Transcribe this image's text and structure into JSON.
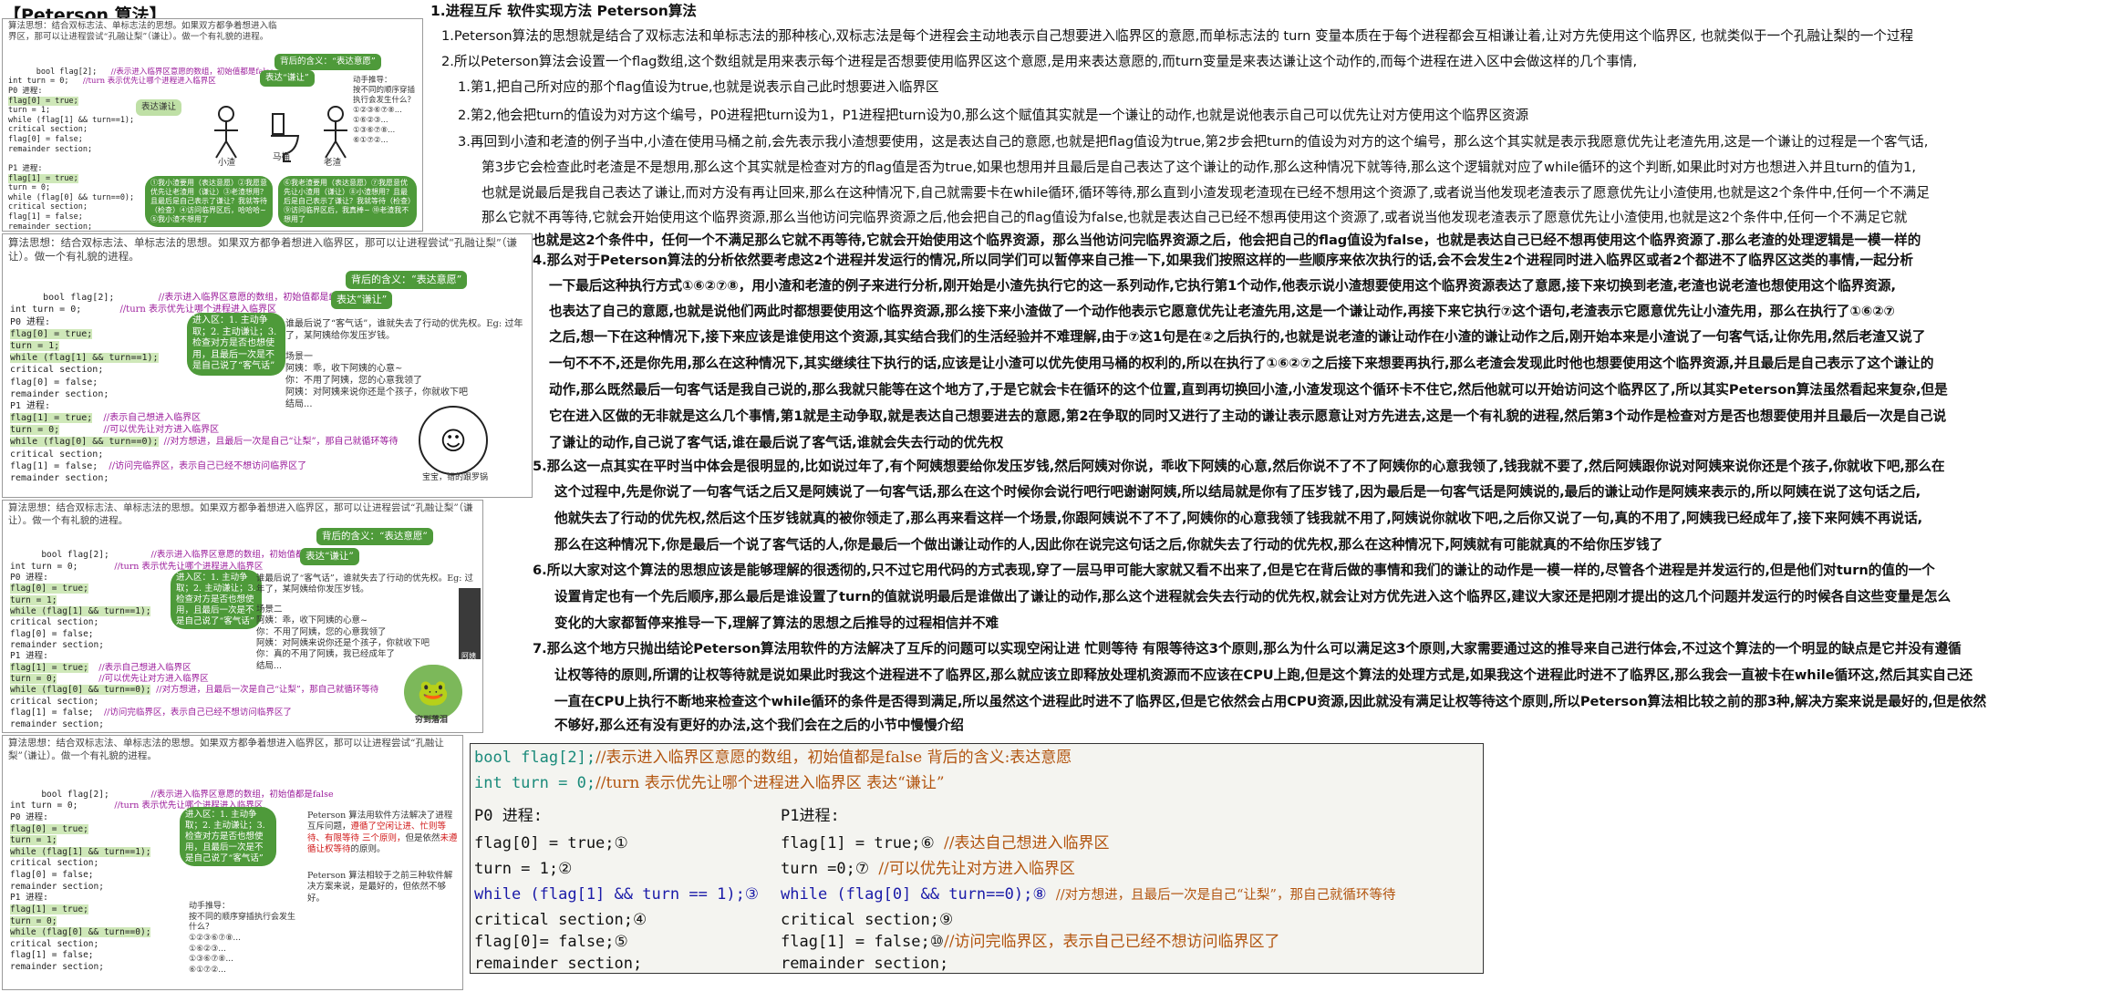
{
  "page_title": "【Peterson 算法】",
  "thumbs": {
    "intro": "算法思想：结合双标志法、单标志法的思想。如果双方都争着想进入临界区，那可以让进程尝试“孔融让梨”（谦让）。做一个有礼貌的进程。",
    "decl_flag": "bool flag[2];",
    "decl_flag_comment": "//表示进入临界区意愿的数组，初始值都是false",
    "decl_turn": "int turn = 0;",
    "decl_turn_comment": "//turn 表示优先让哪个进程进入临界区",
    "p0_label": "P0 进程:",
    "p1_label": "P1 进程:",
    "p0_lines": [
      "flag[0] = true;",
      "turn = 1;",
      "while (flag[1] && turn==1);",
      "critical section;",
      "flag[0] = false;",
      "remainder section;"
    ],
    "p0_nums": [
      "①",
      "②",
      "③",
      "④",
      "⑤"
    ],
    "p1_lines": [
      "flag[1] = true;",
      "turn = 0;",
      "while (flag[0] && turn==0);",
      "critical section;",
      "flag[1] = false;",
      "remainder section;"
    ],
    "p1_nums": [
      "⑥",
      "⑦",
      "⑧",
      "⑨",
      "⑩"
    ],
    "bubble_meaning": "背后的含义：“表达意愿”",
    "bubble_modesty": "表达“谦让”",
    "bubble_mark": "表达谦让",
    "bubble_p0": "①我小渣要用（表达意愿）②我愿意优先让老渣用（谦让）③老渣想用？且最后是自己表示了谦让？我就等待（检查）④访问临界区后，哈哈哈~ ⑤我小渣不想用了",
    "bubble_p1": "⑥我老渣要用（表达意愿）⑦我愿意优先让小渣用（谦让）⑧小渣想用？且最后是自己表示了谦让？我就等待（检查）⑨访问临界区后，我真棒~ ⑩老渣我不想用了",
    "enter_bubble": "进入区：1. 主动争取；2. 主动谦让；3. 检查对方是否也想使用，且最后一次是不是自己说了“客气话”",
    "polite_note": "谁最后说了“客气话”，谁就失去了行动的优先权。Eg: 过年了，某阿姨给你发压岁钱。",
    "scene_one": "场景一\n阿姨：乖，收下阿姨的心意~\n你：不用了阿姨，您的心意我领了\n阿姨：对阿姨来说你还是个孩子，你就收下吧\n结局...",
    "scene_two": "场景二\n阿姨：乖，收下阿姨的心意~\n你：不用了阿姨，您的心意我领了\n阿姨：对阿姨来说你还是个孩子，你就收下吧\n你：真的不用了阿姨，我已经成年了\n结局...",
    "p1_comment_1": "//表示自己想进入临界区",
    "p1_comment_2": "//可以优先让对方进入临界区",
    "p1_comment_3": "//对方想进，且最后一次是自己“让梨”，那自己就循环等待",
    "p1_comment_4": "//访问完临界区，表示自己已经不想访问临界区了",
    "stick_labels": [
      "小渣",
      "马桶",
      "老渣"
    ],
    "stick_thought": "动手推导：\n按不同的顺序穿插执行会发生什么？\n①②③⑥⑦⑧...\n①⑥②③...\n①③⑥⑦⑧...\n⑥①⑦②...",
    "meme_caption_1": "宝宝，错的跟罗锅",
    "meme_caption_2": "穷到落泪",
    "pet_label": "阿姨",
    "summary_note_a": "Peterson 算法用软件方法解决了进程互斥问题，",
    "summary_note_red": "遵循了空闲让进、忙则等待、有限等待 三个原则，",
    "summary_note_b": "但是依然",
    "summary_note_red2": "未遵循让权等待",
    "summary_note_c": "的原则。",
    "summary_note_2": "Peterson 算法相较于之前三种软件解决方案来说，是最好的，但依然不够好。"
  },
  "main": {
    "heading": "1.进程互斥 软件实现方法 Peterson算法",
    "lines": [
      "1.Peterson算法的思想就是结合了双标志法和单标志法的那种核心,双标志法是每个进程会主动地表示自己想要进入临界区的意愿,而单标志法的 turn 变量本质在于每个进程都会互相谦让着,让对方先使用这个临界区,   也就类似于一个孔融让梨的一个过程",
      "2.所以Peterson算法会设置一个flag数组,这个数组就是用来表示每个进程是否想要使用临界区这个意愿,是用来表达意愿的,而turn变量是来表达谦让这个动作的,而每个进程在进入区中会做这样的几个事情,",
      "1.第1,把自己所对应的那个flag值设为true,也就是说表示自己此时想要进入临界区",
      "2.第2,他会把turn的值设为对方这个编号，P0进程把turn设为1，P1进程把turn设为0,那么这个赋值其实就是一个谦让的动作,也就是说他表示自己可以优先让对方使用这个临界区资源",
      "3.再回到小渣和老渣的例子当中,小渣在使用马桶之前,会先表示我小渣想要使用，这是表达自己的意愿,也就是把flag值设为true,第2步会把turn的值设为对方的这个编号，那么这个其实就是表示我愿意优先让老渣先用,这是一个谦让的过程是一个客气话,",
      "第3步它会检查此时老渣是不是想用,那么这个其实就是检查对方的flag值是否为true,如果也想用并且最后是自己表达了这个谦让的动作,那么这种情况下就等待,那么这个逻辑就对应了while循环的这个判断,如果此时对方也想进入并且turn的值为1,",
      "也就是说最后是我自己表达了谦让,而对方没有再让回来,那么在这种情况下,自己就需要卡在while循环,循环等待,那么直到小渣发现老渣现在已经不想用这个资源了,或者说当他发现老渣表示了愿意优先让小渣使用,也就是这2个条件中,任何一个不满足",
      "那么它就不再等待,它就会开始使用这个临界资源,那么当他访问完临界资源之后,他会把自己的flag值设为false,也就是表达自己已经不想再使用这个资源了,或者说当他发现老渣表示了愿意优先让小渣使用,也就是这2个条件中,任何一个不满足它就",
      "也就是这2个条件中，任何一个不满足那么它就不再等待,它就会开始使用这个临界资源，那么当他访问完临界资源之后，他会把自己的flag值设为false，也就是表达自己已经不想再使用这个临界资源了.那么老渣的处理逻辑是一模一样的",
      "4.那么对于Peterson算法的分析依然要考虑这2个进程并发运行的情况,所以同学们可以暂停来自己推一下,如果我们按照这样的一些顺序来依次执行的话,会不会发生2个进程同时进入临界区或者2个都进不了临界区这类的事情,一起分析",
      "一下最后这种执行方式①⑥②⑦⑧，用小渣和老渣的例子来进行分析,刚开始是小渣先执行它的这一系列动作,它执行第1个动作,他表示说小渣想要使用这个临界资源表达了意愿,接下来切换到老渣,老渣也说老渣也想使用这个临界资源,",
      "也表达了自己的意愿,也就是说他们两此时都想要使用这个临界资源,那么接下来小渣做了一个动作他表示它愿意优先让老渣先用,这是一个谦让动作,再接下来它执行⑦这个语句,老渣表示它愿意优先让小渣先用，那么在执行了①⑥②⑦",
      "之后,想一下在这种情况下,接下来应该是谁使用这个资源,其实结合我们的生活经验并不难理解,由于⑦这1句是在②之后执行的,也就是说老渣的谦让动作在小渣的谦让动作之后,刚开始本来是小渣说了一句客气话,让你先用,然后老渣又说了",
      "一句不不不,还是你先用,那么在这种情况下,其实继续往下执行的话,应该是让小渣可以优先使用马桶的权利的,所以在执行了①⑥②⑦之后接下来想要再执行,那么老渣会发现此时他也想要使用这个临界资源,并且最后是自己表示了这个谦让的",
      "动作,那么既然最后一句客气话是我自己说的,那么我就只能等在这个地方了,于是它就会卡在循环的这个位置,直到再切换回小渣,小渣发现这个循环卡不住它,然后他就可以开始访问这个临界区了,所以其实Peterson算法虽然看起来复杂,但是",
      "它在进入区做的无非就是这么几个事情,第1就是主动争取,就是表达自己想要进去的意愿,第2在争取的同时又进行了主动的谦让表示愿意让对方先进去,这是一个有礼貌的进程,然后第3个动作是检查对方是否也想要使用并且最后一次是自己说",
      "了谦让的动作,自己说了客气话,谁在最后说了客气话,谁就会失去行动的优先权",
      "5.那么这一点其实在平时当中体会是很明显的,比如说过年了,有个阿姨想要给你发压岁钱,然后阿姨对你说，乖收下阿姨的心意,然后你说不了不了阿姨你的心意我领了,钱我就不要了,然后阿姨跟你说对阿姨来说你还是个孩子,你就收下吧,那么在",
      "这个过程中,先是你说了一句客气话之后又是阿姨说了一句客气话,那么在这个时候你会说行吧行吧谢谢阿姨,所以结局就是你有了压岁钱了,因为最后是一句客气话是阿姨说的,最后的谦让动作是阿姨来表示的,所以阿姨在说了这句话之后,",
      "他就失去了行动的优先权,然后这个压岁钱就真的被你领走了,那么再来看这样一个场景,你跟阿姨说不了不了,阿姨你的心意我领了钱我就不用了,阿姨说你就收下吧,之后你又说了一句,真的不用了,阿姨我已经成年了,接下来阿姨不再说话,",
      "那么在这种情况下,你是最后一个说了客气话的人,你是最后一个做出谦让动作的人,因此你在说完这句话之后,你就失去了行动的优先权,那么在这种情况下,阿姨就有可能就真的不给你压岁钱了",
      "6.所以大家对这个算法的思想应该是能够理解的很透彻的,只不过它用代码的方式表现,穿了一层马甲可能大家就又看不出来了,但是它在背后做的事情和我们的谦让的动作是一模一样的,尽管各个进程是并发运行的,但是他们对turn的值的一个",
      "设置肯定也有一个先后顺序,那么最后是谁设置了turn的值就说明最后是谁做出了谦让的动作,那么这个进程就会失去行动的优先权,就会让对方优先进入这个临界区,建议大家还是把刚才提出的这几个问题并发运行的时候各自这些变量是怎么",
      "变化的大家都暂停来推导一下,理解了算法的思想之后推导的过程相信并不难",
      "7.那么这个地方只抛出结论Peterson算法用软件的方法解决了互斥的问题可以实现空闲让进 忙则等待 有限等待这3个原则,那么为什么可以满足这3个原则,大家需要通过这的推导来自己进行体会,不过这个算法的一个明显的缺点是它并没有遵循",
      "让权等待的原则,所谓的让权等待就是说如果此时我这个进程进不了临界区,那么就应该立即释放处理机资源而不应该在CPU上跑,但是这个算法的处理方式是,如果我这个进程此时进不了临界区,那么我会一直被卡在while循环这,然后其实自己还",
      "一直在CPU上执行不断地来检查这个while循环的条件是否得到满足,所以虽然这个进程此时进不了临界区,但是它依然会占用CPU资源,因此就没有满足让权等待这个原则,所以Peterson算法相比较之前的那3种,解决方案来说是最好的,但是依然",
      "不够好,那么还有没有更好的办法,这个我们会在之后的小节中慢慢介绍"
    ]
  },
  "code_box": {
    "line1_code": "bool flag[2];",
    "line1_comment": "//表示进入临界区意愿的数组，初始值都是false 背后的含义:表达意愿",
    "line2_code": "int turn = 0;",
    "line2_comment": "//turn 表示优先让哪个进程进入临界区 表达“谦让”",
    "p0_label": "P0 进程:",
    "p1_label": "P1进程:",
    "p0": [
      "flag[0] = true;①",
      "turn = 1;②",
      "while (flag[1] && turn == 1);③",
      "critical section;④",
      "flag[0]= false;⑤",
      "remainder section;"
    ],
    "p1": [
      "flag[1] = true;⑥",
      "turn =0;⑦",
      "while (flag[0] && turn==0);⑧",
      "critical section;⑨",
      "flag[1] = false;⑩",
      "remainder section;"
    ],
    "p1_comments": [
      "//表达自己想进入临界区",
      "//可以优先让对方进入临界区",
      "//对方想进，且最后一次是自己“让梨”，那自己就循环等待",
      "",
      "//访问完临界区，表示自己已经不想访问临界区了",
      ""
    ]
  },
  "colors": {
    "bubble_green": "#4e9a3a",
    "code_box_bg": "#f4f4f0",
    "comment_orange": "#b2540e",
    "keyword_blue": "#1a1aa8"
  }
}
